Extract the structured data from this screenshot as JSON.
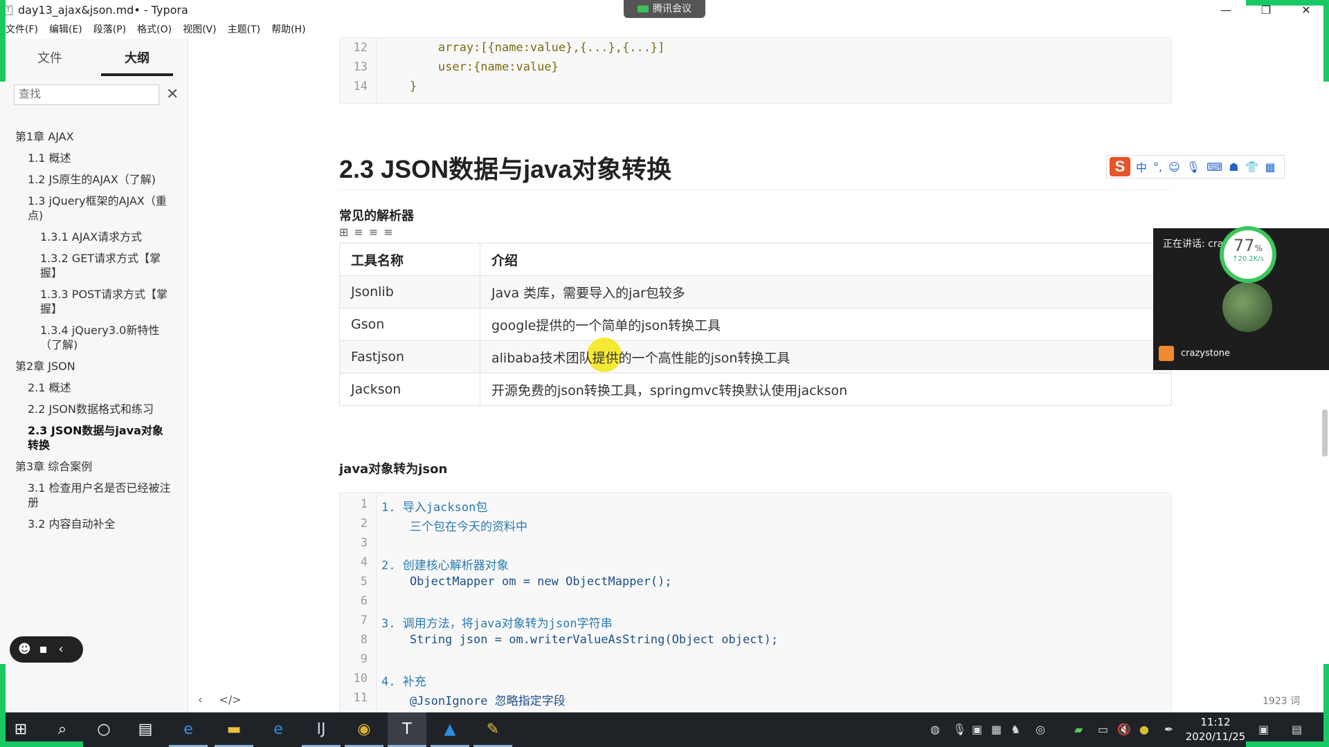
{
  "window": {
    "title": "day13_ajax&json.md• - Typora",
    "controls": {
      "minimize": "—",
      "restore": "❐",
      "close": "✕"
    }
  },
  "meeting": {
    "tag": "腾讯会议",
    "speaking_label": "正在讲话: cra",
    "speaker_name": "crazystone",
    "net_percent": "77",
    "net_percent_unit": "%",
    "net_rate": "↑20.2K/s"
  },
  "menu": [
    "文件(F)",
    "编辑(E)",
    "段落(P)",
    "格式(O)",
    "视图(V)",
    "主题(T)",
    "帮助(H)"
  ],
  "sidebar": {
    "tabs": [
      {
        "label": "文件",
        "active": false
      },
      {
        "label": "大纲",
        "active": true
      }
    ],
    "search_placeholder": "查找",
    "outline": [
      {
        "label": "第1章 AJAX",
        "level": 1
      },
      {
        "label": "1.1 概述",
        "level": 2
      },
      {
        "label": "1.2 JS原生的AJAX（了解)",
        "level": 2
      },
      {
        "label": "1.3 jQuery框架的AJAX（重点)",
        "level": 2
      },
      {
        "label": "1.3.1 AJAX请求方式",
        "level": 3
      },
      {
        "label": "1.3.2 GET请求方式【掌握】",
        "level": 3
      },
      {
        "label": "1.3.3 POST请求方式【掌握】",
        "level": 3
      },
      {
        "label": "1.3.4 jQuery3.0新特性（了解)",
        "level": 3
      },
      {
        "label": "第2章 JSON",
        "level": 1
      },
      {
        "label": "2.1 概述",
        "level": 2
      },
      {
        "label": "2.2 JSON数据格式和练习",
        "level": 2
      },
      {
        "label": "2.3 JSON数据与java对象转换",
        "level": 2,
        "active": true
      },
      {
        "label": "第3章 综合案例",
        "level": 1
      },
      {
        "label": "3.1 检查用户名是否已经被注册",
        "level": 2
      },
      {
        "label": "3.2 内容自动补全",
        "level": 2
      }
    ]
  },
  "editor": {
    "top_code": [
      {
        "ln": "12",
        "text": "        array:[{name:value},{...},{...}]"
      },
      {
        "ln": "13",
        "text": "        user:{name:value}"
      },
      {
        "ln": "14",
        "text": "    }"
      }
    ],
    "heading": "2.3 JSON数据与java对象转换",
    "parsers_heading": "常见的解析器",
    "table": {
      "headers": [
        "工具名称",
        "介绍"
      ],
      "rows": [
        [
          "Jsonlib",
          "Java 类库，需要导入的jar包较多"
        ],
        [
          "Gson",
          "google提供的一个简单的json转换工具"
        ],
        [
          "Fastjson",
          "alibaba技术团队提供的一个高性能的json转换工具"
        ],
        [
          "Jackson",
          "开源免费的json转换工具，springmvc转换默认使用jackson"
        ]
      ]
    },
    "java2json_heading": "java对象转为json",
    "java_code": [
      {
        "ln": "1",
        "text": "1. 导入jackson包"
      },
      {
        "ln": "2",
        "text": "    三个包在今天的资料中"
      },
      {
        "ln": "3",
        "text": ""
      },
      {
        "ln": "4",
        "text": "2. 创建核心解析器对象"
      },
      {
        "ln": "5",
        "text": "    ObjectMapper om = new ObjectMapper();"
      },
      {
        "ln": "6",
        "text": ""
      },
      {
        "ln": "7",
        "text": "3. 调用方法，将java对象转为json字符串"
      },
      {
        "ln": "8",
        "text": "    String json = om.writerValueAsString(Object object);"
      },
      {
        "ln": "9",
        "text": ""
      },
      {
        "ln": "10",
        "text": "4. 补充"
      },
      {
        "ln": "11",
        "text": "    @JsonIgnore 忽略指定字段"
      }
    ],
    "word_count": "1923 词"
  },
  "taskbar": {
    "time": "11:12",
    "date": "2020/11/25"
  }
}
